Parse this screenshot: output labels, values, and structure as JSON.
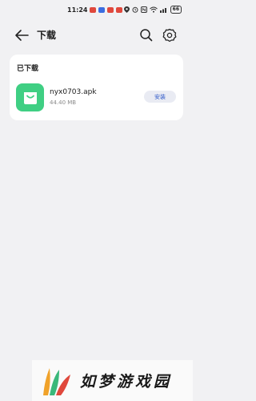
{
  "status_bar": {
    "time": "11:24",
    "battery": "66",
    "notif_colors": [
      "#e0483c",
      "#3b6de0",
      "#e0483c",
      "#e0483c"
    ]
  },
  "header": {
    "title": "下载",
    "back_icon": "arrow-left-icon",
    "search_icon": "search-icon",
    "settings_icon": "gear-icon"
  },
  "downloaded": {
    "section_title": "已下载",
    "items": [
      {
        "file_name": "nyx0703.apk",
        "file_size": "44.40 MB",
        "icon": "shopping-bag-icon",
        "icon_color": "#3fcf83",
        "action_label": "安装"
      }
    ]
  },
  "watermark": {
    "text": "如梦游戏园"
  },
  "colors": {
    "background": "#f1f1f3",
    "accent": "#2f59c9",
    "app_icon": "#3fcf83"
  }
}
